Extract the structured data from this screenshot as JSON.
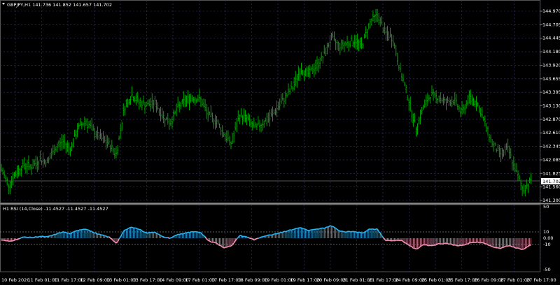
{
  "main_panel": {
    "header": "GBPJPY,H1  141.736 141.852 141.657 141.702",
    "current_price": "141.702",
    "price_scale": [
      "144.970",
      "144.705",
      "144.445",
      "144.180",
      "143.920",
      "143.655",
      "143.395",
      "143.130",
      "142.870",
      "142.610",
      "142.345",
      "142.085",
      "141.825",
      "141.560",
      "141.300"
    ]
  },
  "indicator_panel": {
    "header": "H1 RSI (14,Close) -11.4527 -11.4527 -11.4527",
    "scale": [
      "50",
      "10",
      "0.00",
      "-10",
      "-50"
    ]
  },
  "time_axis": [
    "10 Feb 2020",
    "11 Feb 01:00",
    "11 Feb 17:00",
    "12 Feb 09:00",
    "13 Feb 01:00",
    "13 Feb 17:00",
    "14 Feb 09:00",
    "17 Feb 01:00",
    "17 Feb 17:00",
    "18 Feb 09:00",
    "19 Feb 01:00",
    "19 Feb 17:00",
    "20 Feb 09:00",
    "21 Feb 01:00",
    "21 Feb 17:00",
    "24 Feb 09:00",
    "25 Feb 01:00",
    "25 Feb 17:00",
    "26 Feb 09:00",
    "27 Feb 01:00",
    "27 Feb 17:00"
  ],
  "colors": {
    "bull_bars": "#00b400",
    "grid": "#3a3a6a",
    "rsi_up": "#29b6f6",
    "rsi_down": "#f48fb1",
    "price_tag_bg": "#ffffff"
  },
  "chart_data": {
    "type": "ohlc",
    "symbol": "GBPJPY",
    "timeframe": "H1",
    "close_trend": [
      141.9,
      141.6,
      141.85,
      142.0,
      141.95,
      142.1,
      142.05,
      142.3,
      142.45,
      142.3,
      142.7,
      142.85,
      142.65,
      142.5,
      142.4,
      142.2,
      143.1,
      143.35,
      143.2,
      143.15,
      143.2,
      142.95,
      142.8,
      143.1,
      143.25,
      143.3,
      143.25,
      142.95,
      142.85,
      142.6,
      142.4,
      142.95,
      142.9,
      142.7,
      142.8,
      142.9,
      143.1,
      143.3,
      143.5,
      143.85,
      143.75,
      143.9,
      144.1,
      144.45,
      144.3,
      144.35,
      144.4,
      144.3,
      144.75,
      144.9,
      144.55,
      144.45,
      143.8,
      143.3,
      142.7,
      143.1,
      143.35,
      143.3,
      143.2,
      143.25,
      143.0,
      143.3,
      143.2,
      142.8,
      142.4,
      142.2,
      142.3,
      141.9,
      141.5,
      141.7
    ],
    "rsi_trend": [
      -3,
      -5,
      -2,
      2,
      1,
      3,
      2,
      6,
      10,
      7,
      13,
      15,
      9,
      5,
      2,
      -8,
      12,
      18,
      14,
      8,
      10,
      2,
      0,
      6,
      8,
      10,
      9,
      -4,
      -8,
      -15,
      -12,
      4,
      2,
      -3,
      3,
      5,
      8,
      11,
      14,
      17,
      12,
      14,
      16,
      20,
      12,
      10,
      11,
      8,
      15,
      14,
      -3,
      -4,
      -3,
      -10,
      -18,
      -10,
      -12,
      -9,
      -8,
      -11,
      -12,
      -8,
      -6,
      -8,
      -14,
      -16,
      -12,
      -15,
      -18,
      -11
    ]
  }
}
